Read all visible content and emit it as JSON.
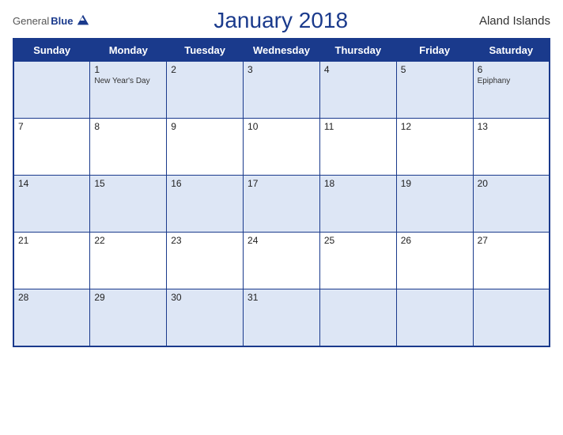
{
  "header": {
    "logo_general": "General",
    "logo_blue": "Blue",
    "title": "January 2018",
    "region": "Aland Islands"
  },
  "weekdays": [
    "Sunday",
    "Monday",
    "Tuesday",
    "Wednesday",
    "Thursday",
    "Friday",
    "Saturday"
  ],
  "weeks": [
    [
      {
        "day": "",
        "holiday": ""
      },
      {
        "day": "1",
        "holiday": "New Year's Day"
      },
      {
        "day": "2",
        "holiday": ""
      },
      {
        "day": "3",
        "holiday": ""
      },
      {
        "day": "4",
        "holiday": ""
      },
      {
        "day": "5",
        "holiday": ""
      },
      {
        "day": "6",
        "holiday": "Epiphany"
      }
    ],
    [
      {
        "day": "7",
        "holiday": ""
      },
      {
        "day": "8",
        "holiday": ""
      },
      {
        "day": "9",
        "holiday": ""
      },
      {
        "day": "10",
        "holiday": ""
      },
      {
        "day": "11",
        "holiday": ""
      },
      {
        "day": "12",
        "holiday": ""
      },
      {
        "day": "13",
        "holiday": ""
      }
    ],
    [
      {
        "day": "14",
        "holiday": ""
      },
      {
        "day": "15",
        "holiday": ""
      },
      {
        "day": "16",
        "holiday": ""
      },
      {
        "day": "17",
        "holiday": ""
      },
      {
        "day": "18",
        "holiday": ""
      },
      {
        "day": "19",
        "holiday": ""
      },
      {
        "day": "20",
        "holiday": ""
      }
    ],
    [
      {
        "day": "21",
        "holiday": ""
      },
      {
        "day": "22",
        "holiday": ""
      },
      {
        "day": "23",
        "holiday": ""
      },
      {
        "day": "24",
        "holiday": ""
      },
      {
        "day": "25",
        "holiday": ""
      },
      {
        "day": "26",
        "holiday": ""
      },
      {
        "day": "27",
        "holiday": ""
      }
    ],
    [
      {
        "day": "28",
        "holiday": ""
      },
      {
        "day": "29",
        "holiday": ""
      },
      {
        "day": "30",
        "holiday": ""
      },
      {
        "day": "31",
        "holiday": ""
      },
      {
        "day": "",
        "holiday": ""
      },
      {
        "day": "",
        "holiday": ""
      },
      {
        "day": "",
        "holiday": ""
      }
    ]
  ]
}
